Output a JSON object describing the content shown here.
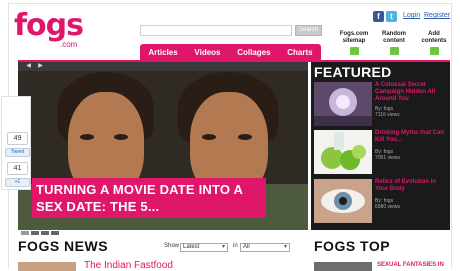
{
  "brand": {
    "name": "fogs",
    "suffix": ".com"
  },
  "header": {
    "social": {
      "facebook": "f",
      "twitter": "t"
    },
    "login": "Login",
    "register": "Register",
    "search_button": "Search",
    "quick_links": [
      {
        "label": "Fogs.com\nsitemap",
        "icon": "sitemap-icon"
      },
      {
        "label": "Random\ncontent",
        "icon": "shuffle-icon"
      },
      {
        "label": "Add\ncontents",
        "icon": "plus-icon"
      }
    ]
  },
  "nav": {
    "tabs": [
      "Articles",
      "Videos",
      "Collages",
      "Charts"
    ]
  },
  "slideshow": {
    "caption": "TURNING A MOVIE DATE INTO A SEX DATE: THE 5...",
    "prev": "◀",
    "next": "▶"
  },
  "share": {
    "top_count": "49",
    "tweet": "Tweet",
    "bottom_count": "41",
    "plus": "+1"
  },
  "featured": {
    "title": "FEATURED",
    "items": [
      {
        "title": "A Colossal Secret Campaign Hidden All Around You",
        "by": "By: fogs",
        "views": "7116 views"
      },
      {
        "title": "Drinking Myths that Can Kill You...",
        "by": "By: fogs",
        "views": "7051 views"
      },
      {
        "title": "Relics of Evolution in Your Body",
        "by": "By: fogs",
        "views": "6980 views"
      }
    ]
  },
  "news": {
    "title": "FOGS NEWS",
    "show_label": "Show",
    "show_value": "Latest",
    "in_label": "in",
    "in_value": "All",
    "headline": "The Indian Fastfood"
  },
  "top": {
    "title": "FOGS TOP",
    "headline": "SEXUAL FANTASIES IN"
  },
  "colors": {
    "brand": "#e0166b",
    "featured_bg": "#1a1a1a"
  }
}
